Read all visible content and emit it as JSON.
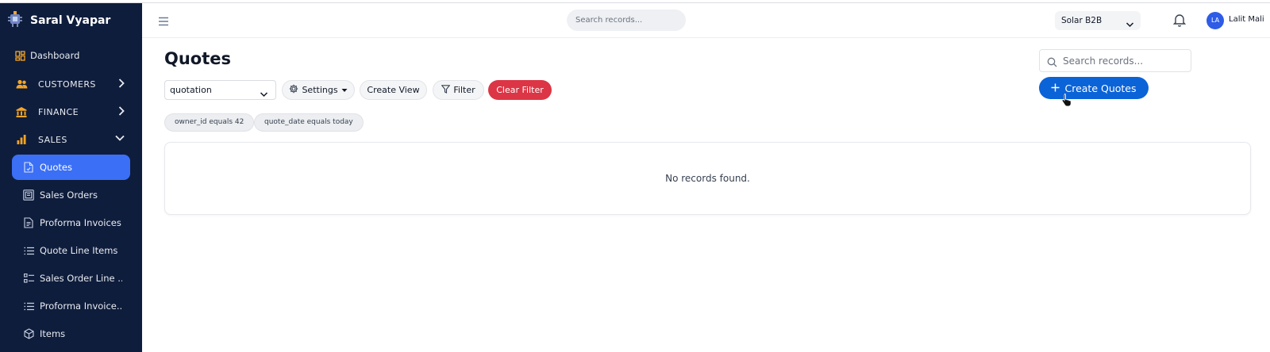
{
  "app": {
    "name": "Saral Vyapar"
  },
  "sidebar": {
    "dashboard": "Dashboard",
    "sections": [
      {
        "label": "CUSTOMERS",
        "expanded": false
      },
      {
        "label": "FINANCE",
        "expanded": false
      },
      {
        "label": "SALES",
        "expanded": true
      }
    ],
    "sales_items": [
      {
        "label": "Quotes",
        "active": true
      },
      {
        "label": "Sales Orders"
      },
      {
        "label": "Proforma Invoices"
      },
      {
        "label": "Quote Line Items"
      },
      {
        "label": "Sales Order Line ..."
      },
      {
        "label": "Proforma Invoice..."
      },
      {
        "label": "Items"
      }
    ]
  },
  "header": {
    "search_placeholder": "Search records...",
    "org": "Solar B2B",
    "user_initials": "LA",
    "user_name": "Lalit Mali"
  },
  "page": {
    "title": "Quotes",
    "view_select": "quotation",
    "settings_label": "Settings",
    "create_view_label": "Create View",
    "filter_label": "Filter",
    "clear_filter_label": "Clear Filter",
    "filter_chips": [
      "owner_id equals 42",
      "quote_date equals today"
    ],
    "search_placeholder": "Search records...",
    "create_label": "Create Quotes",
    "empty_text": "No records found."
  },
  "colors": {
    "sidebar_bg": "#0f1d3c",
    "active_item": "#3b6ff5",
    "primary": "#0b63d8",
    "danger": "#dc3545",
    "section_icon": "#f5a524"
  },
  "icons": [
    "app-logo",
    "dashboard-icon",
    "customers-icon",
    "finance-icon",
    "sales-icon",
    "document-icon",
    "list-icon",
    "cube-icon",
    "menu-icon",
    "bell-icon",
    "search-icon",
    "gear-icon",
    "filter-icon",
    "plus-icon",
    "chevron-down-icon",
    "chevron-right-icon"
  ]
}
